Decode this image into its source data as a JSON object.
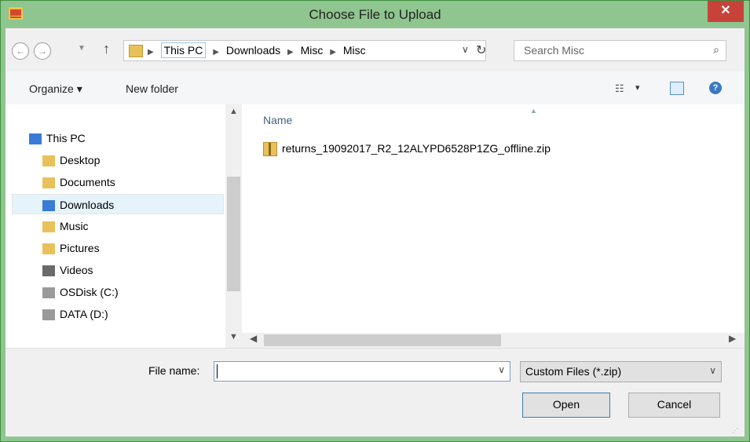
{
  "window": {
    "title": "Choose File to Upload",
    "close_label": "✕"
  },
  "address_bar": {
    "back_icon": "←",
    "forward_icon": "→",
    "recent_icon": "▼",
    "up_icon": "↑",
    "crumbs": [
      "This PC",
      "Downloads",
      "Misc",
      "Misc"
    ],
    "refresh_icon": "↻",
    "dropdown_icon": "∨"
  },
  "search": {
    "placeholder": "Search Misc",
    "icon": "⌕"
  },
  "toolbar": {
    "organize_label": "Organize ▾",
    "new_folder_label": "New folder",
    "views_icon": "☷",
    "views_dropdown": "▾",
    "help_label": "?"
  },
  "nav": {
    "items": [
      {
        "label": "This PC",
        "icon": "monitor-icon"
      },
      {
        "label": "Desktop",
        "icon": "desktop-folder-icon"
      },
      {
        "label": "Documents",
        "icon": "documents-folder-icon"
      },
      {
        "label": "Downloads",
        "icon": "downloads-folder-icon",
        "selected": true
      },
      {
        "label": "Music",
        "icon": "music-folder-icon"
      },
      {
        "label": "Pictures",
        "icon": "pictures-folder-icon"
      },
      {
        "label": "Videos",
        "icon": "videos-folder-icon"
      },
      {
        "label": "OSDisk (C:)",
        "icon": "drive-icon"
      },
      {
        "label": "DATA (D:)",
        "icon": "drive-icon"
      }
    ]
  },
  "file_list": {
    "column_name": "Name",
    "files": [
      {
        "name": "returns_19092017_R2_12ALYPD6528P1ZG_offline.zip"
      }
    ]
  },
  "bottom": {
    "file_name_label": "File name:",
    "file_name_value": "",
    "filter_value": "Custom Files (*.zip)",
    "open_label": "Open",
    "cancel_label": "Cancel"
  }
}
